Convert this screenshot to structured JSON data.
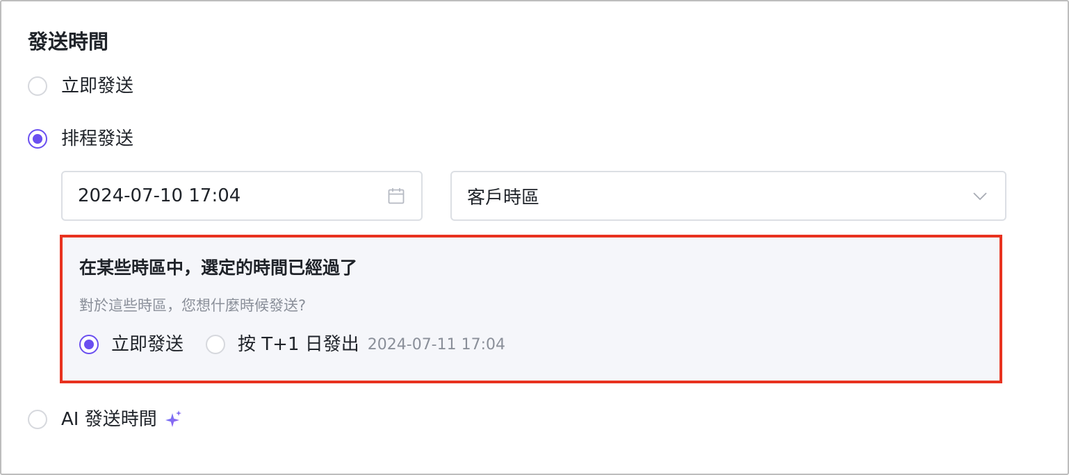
{
  "section": {
    "title": "發送時間"
  },
  "options": {
    "immediate": {
      "label": "立即發送",
      "checked": false
    },
    "scheduled": {
      "label": "排程發送",
      "checked": true
    },
    "ai": {
      "label": "AI 發送時間",
      "checked": false,
      "icon": "sparkle-icon"
    }
  },
  "schedule": {
    "datetime_value": "2024-07-10 17:04",
    "datetime_icon": "calendar-icon",
    "timezone_value": "客戶時區",
    "timezone_icon": "chevron-down-icon"
  },
  "warning": {
    "title": "在某些時區中，選定的時間已經過了",
    "description": "對於這些時區，您想什麼時候發送?",
    "options": [
      {
        "label": "立即發送",
        "checked": true
      },
      {
        "label": "按 T+1 日發出",
        "checked": false,
        "sub_value": "2024-07-11 17:04"
      }
    ]
  },
  "colors": {
    "accent": "#6a4ff0",
    "highlight_border": "#e8321f",
    "panel_bg": "#f5f6fa",
    "muted_text": "#8a8f99"
  }
}
